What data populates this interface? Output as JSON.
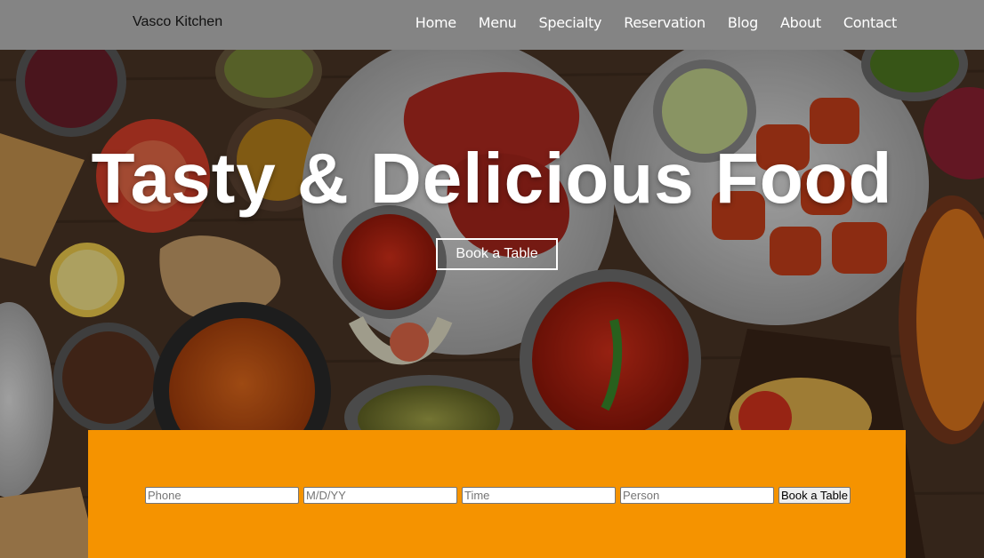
{
  "navbar": {
    "brand": "Vasco Kitchen",
    "links": [
      {
        "label": "Home"
      },
      {
        "label": "Menu"
      },
      {
        "label": "Specialty"
      },
      {
        "label": "Reservation"
      },
      {
        "label": "Blog"
      },
      {
        "label": "About"
      },
      {
        "label": "Contact"
      }
    ]
  },
  "hero": {
    "title": "Tasty & Delicious Food",
    "cta_label": "Book a Table"
  },
  "booking": {
    "fields": [
      {
        "placeholder": "Phone"
      },
      {
        "placeholder": "M/D/YY"
      },
      {
        "placeholder": "Time"
      },
      {
        "placeholder": "Person"
      }
    ],
    "submit_label": "Book a Table"
  },
  "colors": {
    "navbar_bg": "#848484",
    "booking_bg": "#f59300"
  }
}
